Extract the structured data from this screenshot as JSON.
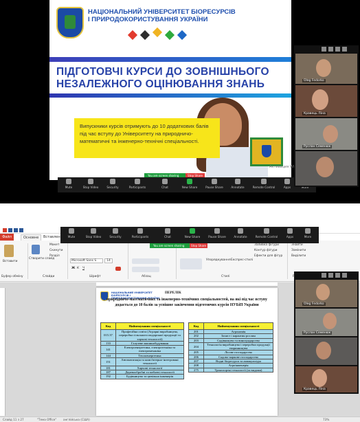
{
  "top": {
    "slide": {
      "university_title": "НАЦІОНАЛЬНИЙ УНІВЕРСИТЕТ БІОРЕСУРСІВ І ПРИРОДОКОРИСТУВАННЯ УКРАЇНИ",
      "headline_line1": "ПІДГОТОВЧІ КУРСИ ДО ЗОВНІШНЬОГО",
      "headline_line2": "НЕЗАЛЕЖНОГО ОЦІНЮВАННЯ ЗНАНЬ",
      "body_text": "Випускники курсів отримують до 10 додаткових балів під час вступу до Університету на природничо-математичні та інженерно-технічні спеціальності."
    },
    "zoom_bar": {
      "screen_sharing": "You are screen sharing",
      "stop_share": "Stop Share",
      "items": [
        "Mute",
        "Stop Video",
        "Security",
        "Participants",
        "Chat",
        "New Share",
        "Pause Share",
        "Annotate",
        "Remote Control",
        "Apps",
        "More"
      ]
    },
    "windows_watermark": "Активация Windows",
    "video_tiles": [
      {
        "name": "Oleg Fedorko"
      },
      {
        "name": "Кравець Ліна"
      },
      {
        "name": "Руслан Семенюк"
      },
      {
        "name": ""
      }
    ],
    "colors": {
      "accent_blue": "#2742a8",
      "yellow_box": "#f7e51a",
      "zoom_green": "#1e9e3e",
      "zoom_red": "#e03b3b"
    }
  },
  "bottom": {
    "word": {
      "tabs": {
        "file": "Файл",
        "home": "Основне",
        "insert": "Вставлення"
      },
      "ribbon": {
        "paste": "Вставити",
        "clipboard_group": "Буфер обміну",
        "font_name": "Microsoft Sans S",
        "font_size": "14",
        "font_group": "Шрифт",
        "paragraph_group": "Абзац",
        "styles_group": "Стилі",
        "editing_group": "Редагування",
        "find": "Знайти",
        "replace": "Замінити",
        "select": "Виділити",
        "slides_group": "Слайди",
        "new_slide": "Створити слайд",
        "layout": "Макет",
        "reset": "Скинути",
        "section": "Розділ",
        "arrange": "Упорядкування",
        "quick_styles": "Експрес-стилі",
        "shape_fill": "Заливка фігури",
        "shape_outline": "Контур фігури",
        "shape_effects": "Ефекти для фігур"
      },
      "status": {
        "slide": "Слайд 11 з 27",
        "theme": "\"Тема Office\"",
        "language": "англійська (США)",
        "zoom": "73%"
      }
    },
    "zoom_bar": {
      "screen_sharing": "You are screen sharing",
      "stop_share": "Stop Share",
      "items": [
        "Mute",
        "Stop Video",
        "Security",
        "Participants",
        "Chat",
        "New Share",
        "Pause Share",
        "Annotate",
        "Remote Control",
        "Apps",
        "More"
      ]
    },
    "doc": {
      "university": "НАЦІОНАЛЬНИЙ УНІВЕРСИТЕТ БІОРЕСУРСІВ І ПРИРОДОКОРИСТУВАННЯ УКРАЇНИ",
      "title": "ПЕРЕЛІК",
      "subtitle": "природничо-математичних та інженерно-технічних спеціальностей, на які під час вступу додається до 10 балів за успішне закінчення підготовчих курсів НУБіП України",
      "table_left": {
        "headers": [
          "Код",
          "Найменування спеціальності"
        ],
        "rows": [
          [
            "015.37",
            "Професійна освіта (Аграрні виробництва, переробка сільськогосподарської продукції та харчові технології)"
          ],
          [
            "133",
            "Галузеве машинобудування"
          ],
          [
            "141",
            "Електроенергетика, електротехніка та електромеханіка"
          ],
          [
            "144",
            "Теплоенергетика"
          ],
          [
            "151",
            "Автоматизація та комп'ютерно-інтегровані технології"
          ],
          [
            "181",
            "Харчові технології"
          ],
          [
            "187",
            "Деревообробні та меблеві технології"
          ],
          [
            "192",
            "Будівництво та цивільна інженерія"
          ]
        ]
      },
      "table_right": {
        "headers": [
          "Код",
          "Найменування спеціальності"
        ],
        "rows": [
          [
            "201",
            "Агрономія"
          ],
          [
            "202",
            "Захист і карантин рослин"
          ],
          [
            "203",
            "Садівництво та виноградарство"
          ],
          [
            "204",
            "Технологія виробництва і переробки продукції тваринництва"
          ],
          [
            "205",
            "Лісове господарство"
          ],
          [
            "206",
            "Садово-паркове господарство"
          ],
          [
            "207",
            "Водні біоресурси та аквакультура"
          ],
          [
            "208",
            "Агроінженерія"
          ],
          [
            "275",
            "Транспортні технології (за видами)"
          ]
        ]
      }
    },
    "video_tiles": [
      {
        "name": "Oleg Fedorko"
      },
      {
        "name": "Руслан Семенюк"
      },
      {
        "name": ""
      },
      {
        "name": "Кравець Ліна"
      }
    ]
  }
}
